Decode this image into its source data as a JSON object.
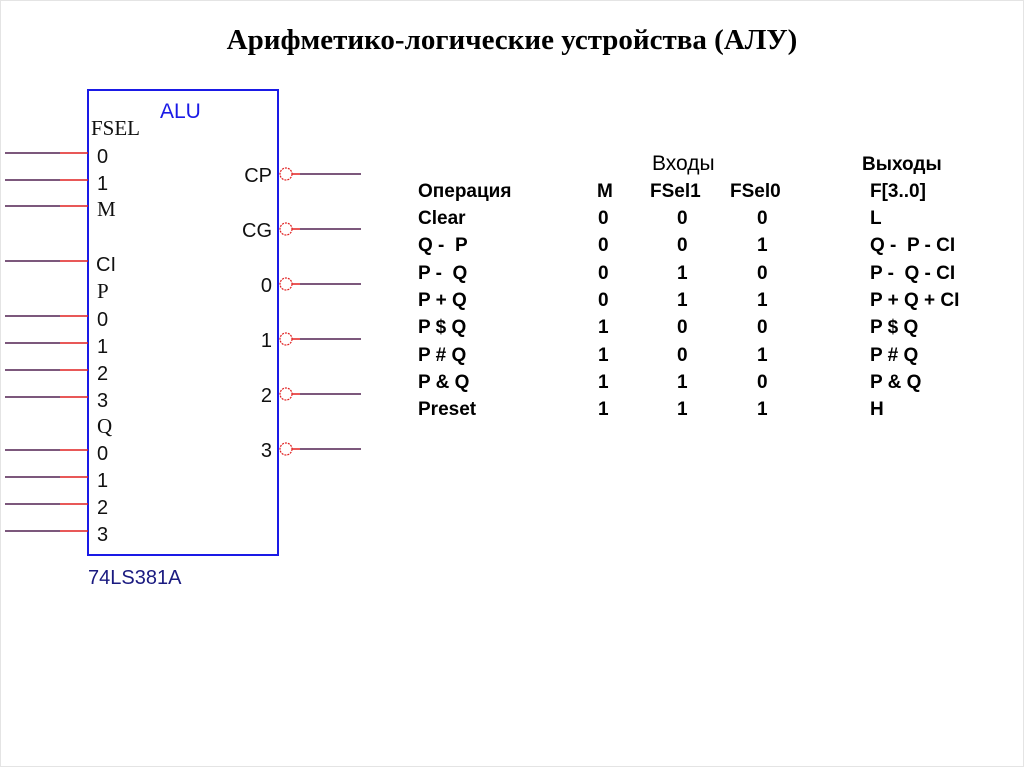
{
  "title": "Арифметико-логические устройства (АЛУ)",
  "chip": {
    "name": "ALU",
    "part": "74LS381A",
    "left_labels": [
      {
        "t": "FSEL",
        "serif": true
      },
      {
        "t": "0"
      },
      {
        "t": "1"
      },
      {
        "t": "M",
        "serif": true
      },
      {
        "t": "CI",
        "serif": false
      },
      {
        "t": "P",
        "serif": true
      },
      {
        "t": "0"
      },
      {
        "t": "1"
      },
      {
        "t": "2"
      },
      {
        "t": "3"
      },
      {
        "t": "Q",
        "serif": true
      },
      {
        "t": "0"
      },
      {
        "t": "1"
      },
      {
        "t": "2"
      },
      {
        "t": "3"
      }
    ],
    "right_labels": [
      "CP",
      "CG",
      "0",
      "1",
      "2",
      "3"
    ],
    "colors": {
      "box": "#1a1ae6",
      "pin": "#e02020",
      "label": "#1a1a80"
    }
  },
  "table": {
    "inputs_header": "Входы",
    "outputs_header": "Выходы",
    "columns": [
      "Операция",
      "M",
      "FSel1",
      "FSel0",
      "F[3..0]"
    ],
    "rows": [
      [
        "Clear",
        "0",
        "0",
        "0",
        "L"
      ],
      [
        "Q -  P",
        "0",
        "0",
        "1",
        "Q -  P - CI"
      ],
      [
        "P -  Q",
        "0",
        "1",
        "0",
        "P -  Q - CI"
      ],
      [
        "P + Q",
        "0",
        "1",
        "1",
        "P + Q + CI"
      ],
      [
        "P $ Q",
        "1",
        "0",
        "0",
        "P $ Q"
      ],
      [
        "P # Q",
        "1",
        "0",
        "1",
        "P # Q"
      ],
      [
        "P & Q",
        "1",
        "1",
        "0",
        "P & Q"
      ],
      [
        "Preset",
        "1",
        "1",
        "1",
        "H"
      ]
    ]
  }
}
